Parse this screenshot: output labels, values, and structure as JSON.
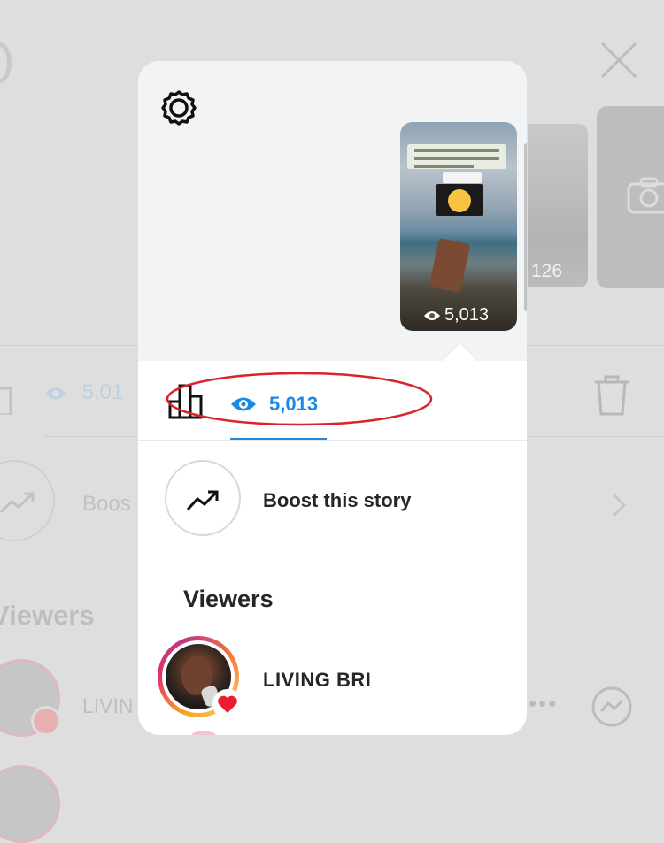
{
  "background": {
    "view_count": "5,01",
    "boost_label": "Boos",
    "viewers_label": "Viewers",
    "viewer_name": "LIVIN",
    "more_dots": "•••",
    "photo_count": "126"
  },
  "popup": {
    "story": {
      "view_count": "5,013"
    },
    "tabs": {
      "views_count": "5,013"
    },
    "boost": {
      "label": "Boost this story"
    },
    "viewers": {
      "heading": "Viewers",
      "items": [
        {
          "name": "LIVING BRI",
          "reaction": "heart-icon"
        }
      ]
    }
  },
  "colors": {
    "accent_blue": "#1e88e5",
    "annotation_red": "#d9232d",
    "heart_red": "#ed1c2e"
  }
}
